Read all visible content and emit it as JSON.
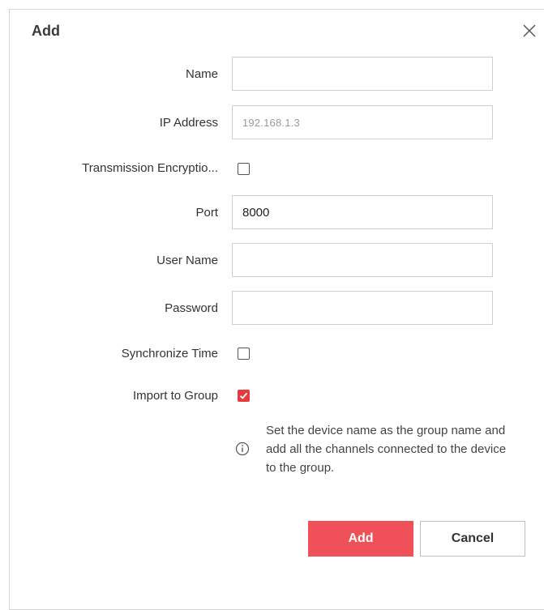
{
  "dialog": {
    "title": "Add",
    "close_icon": "close-icon"
  },
  "form": {
    "name": {
      "label": "Name",
      "value": ""
    },
    "ip_address": {
      "label": "IP Address",
      "value": "192.168.1.3"
    },
    "transmission_encryption": {
      "label": "Transmission Encryptio...",
      "checked": false
    },
    "port": {
      "label": "Port",
      "value": "8000"
    },
    "user_name": {
      "label": "User Name",
      "value": ""
    },
    "password": {
      "label": "Password",
      "value": ""
    },
    "synchronize_time": {
      "label": "Synchronize Time",
      "checked": false
    },
    "import_to_group": {
      "label": "Import to Group",
      "checked": true
    }
  },
  "hint": {
    "icon": "info-icon",
    "line1": "Set the device name as the group name and",
    "line2": "add all the channels connected to the device",
    "line3": "to the group."
  },
  "buttons": {
    "add_label": "Add",
    "cancel_label": "Cancel"
  },
  "colors": {
    "accent": "#f05158",
    "checkbox_checked": "#e8393f"
  }
}
